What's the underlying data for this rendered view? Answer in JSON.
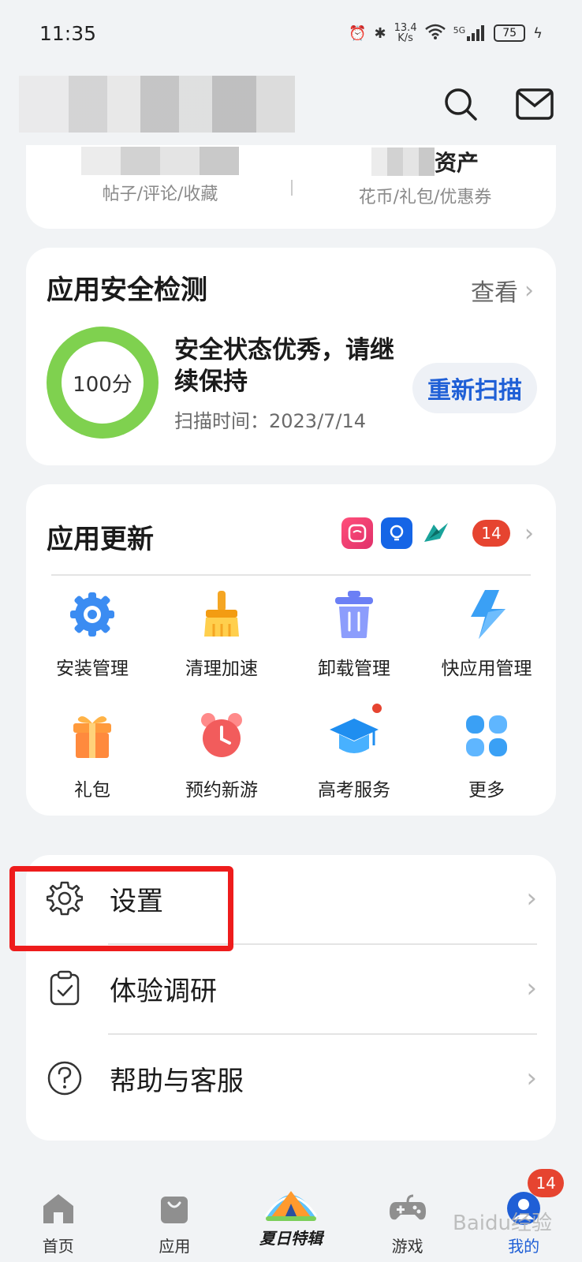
{
  "status": {
    "time": "11:35",
    "speed_top": "13.4",
    "speed_bottom": "K/s",
    "network": "5G",
    "battery": "75"
  },
  "header": {
    "search_icon": "search-icon",
    "mail_icon": "mail-icon"
  },
  "stats": {
    "left_sub": "帖子/评论/收藏",
    "right_title": "资产",
    "right_sub": "花币/礼包/优惠券"
  },
  "security": {
    "title": "应用安全检测",
    "view_label": "查看",
    "score": "100分",
    "message": "安全状态优秀，请继续保持",
    "scan_time": "扫描时间：2023/7/14",
    "rescan_label": "重新扫描",
    "ring_color": "#7fd14f"
  },
  "updates": {
    "title": "应用更新",
    "count": "14",
    "grid": [
      {
        "label": "安装管理",
        "icon": "install-gear-icon"
      },
      {
        "label": "清理加速",
        "icon": "broom-icon"
      },
      {
        "label": "卸载管理",
        "icon": "trash-icon"
      },
      {
        "label": "快应用管理",
        "icon": "lightning-icon"
      },
      {
        "label": "礼包",
        "icon": "gift-icon"
      },
      {
        "label": "预约新游",
        "icon": "alarm-clock-icon"
      },
      {
        "label": "高考服务",
        "icon": "graduation-cap-icon"
      },
      {
        "label": "更多",
        "icon": "more-grid-icon"
      }
    ]
  },
  "menu": {
    "settings": "设置",
    "survey": "体验调研",
    "help": "帮助与客服"
  },
  "nav": {
    "home": "首页",
    "apps": "应用",
    "summer": "夏日特辑",
    "games": "游戏",
    "mine": "我的",
    "mine_badge": "14"
  },
  "watermark": "Baidu经验"
}
